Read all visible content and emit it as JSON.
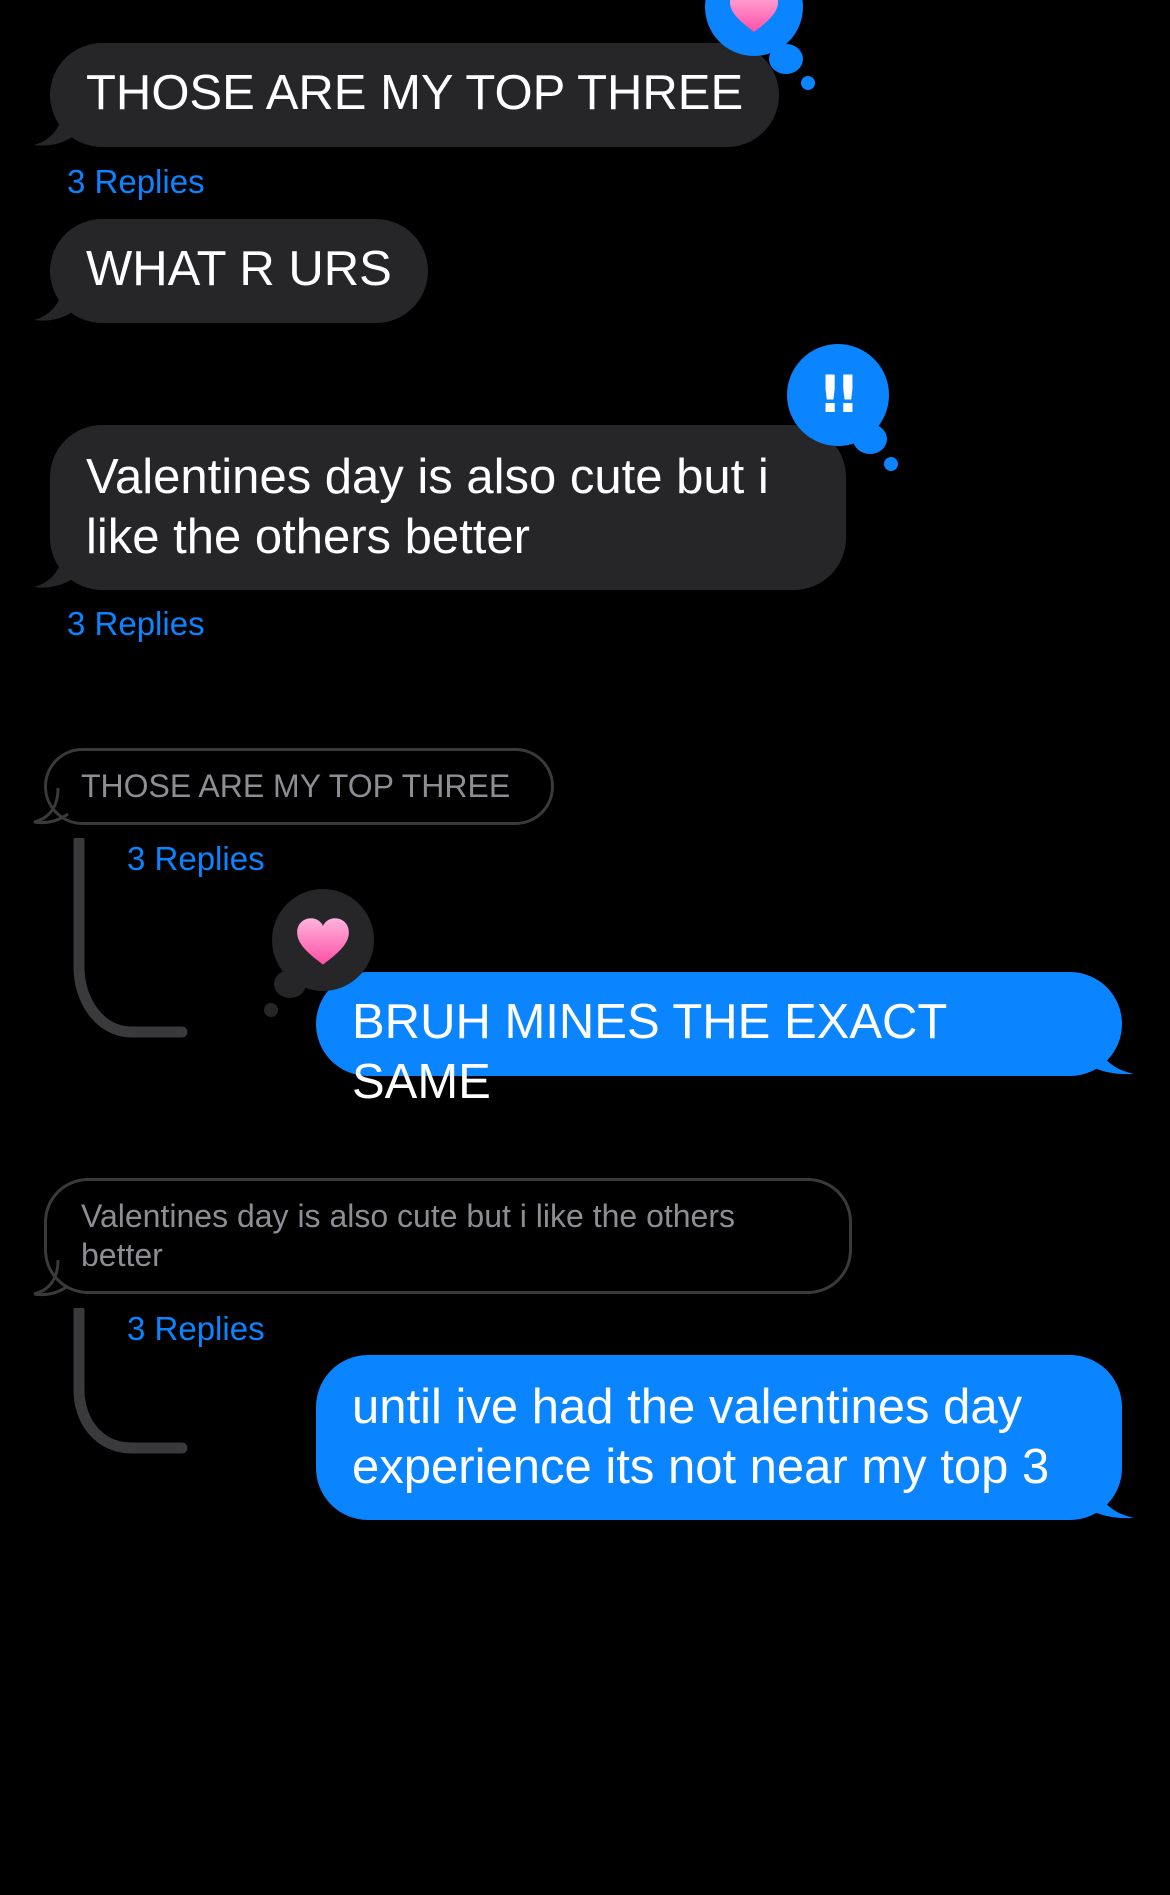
{
  "colors": {
    "background": "#000000",
    "incoming_bubble": "#262628",
    "outgoing_bubble": "#0a84ff",
    "link_blue": "#0a84ff",
    "quote_text": "#8d8d93",
    "thread_line": "#3a3a3c"
  },
  "messages": [
    {
      "text": "THOSE ARE MY TOP THREE",
      "direction": "incoming",
      "replies": "3 Replies",
      "tapback": {
        "icon": "heart-icon",
        "label": "Loved"
      }
    },
    {
      "text": "WHAT R URS",
      "direction": "incoming"
    },
    {
      "text": "Valentines day is also cute but i\nlike the others better",
      "direction": "incoming",
      "replies": "3 Replies",
      "tapback": {
        "icon": "double-exclamation-icon",
        "label": "Emphasized",
        "glyph": "!!"
      }
    }
  ],
  "threads": [
    {
      "quoted_text": "THOSE ARE MY TOP THREE",
      "replies": "3 Replies",
      "reply": {
        "text": "BRUH MINES THE EXACT SAME",
        "direction": "outgoing",
        "tapback": {
          "icon": "heart-icon",
          "label": "Loved"
        }
      }
    },
    {
      "quoted_text": "Valentines day is also cute but i like the others\nbetter",
      "replies": "3 Replies",
      "reply": {
        "text": "until ive had the valentines day\nexperience its not near my top 3",
        "direction": "outgoing"
      }
    }
  ]
}
